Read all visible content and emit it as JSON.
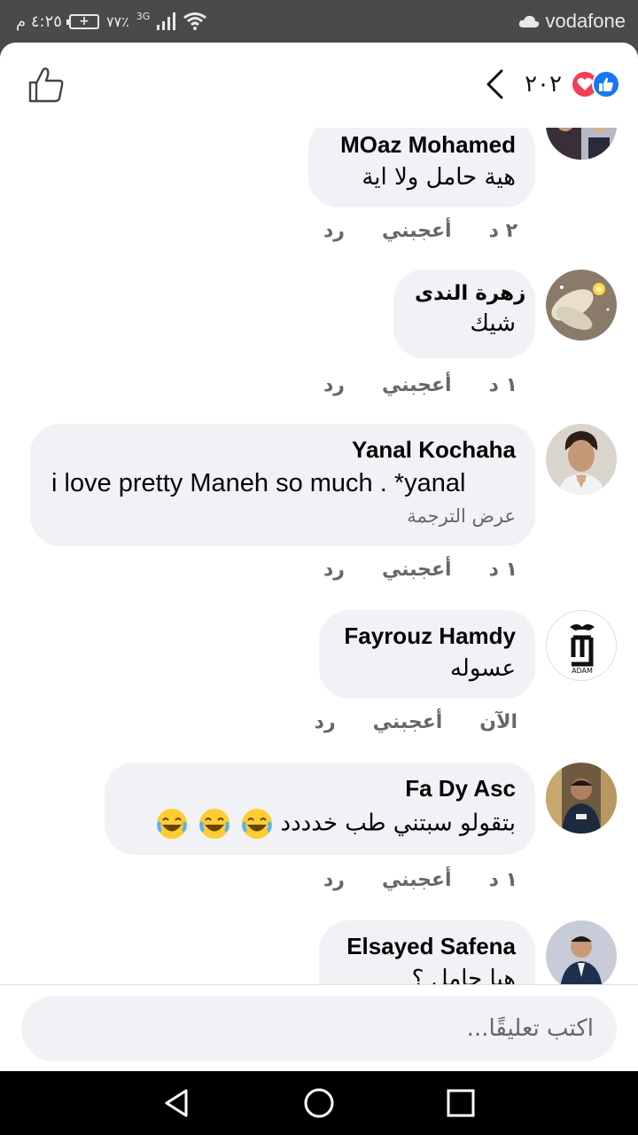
{
  "status_bar": {
    "time": "٤:٢٥ م",
    "battery": "٧٧٪",
    "network": "3G",
    "carrier": "vodafone"
  },
  "header": {
    "reaction_count": "٢٠٢",
    "reactions": [
      "like",
      "love"
    ]
  },
  "comments": [
    {
      "author": "MOaz Mohamed",
      "text": "هية حامل ولا اية",
      "time": "٢ د",
      "like_label": "أعجبني",
      "reply_label": "رد"
    },
    {
      "author": "زهرة الندى",
      "text": "شيك",
      "time": "١ د",
      "like_label": "أعجبني",
      "reply_label": "رد"
    },
    {
      "author": "Yanal Kochaha",
      "text": "i love pretty Maneh so much . *yanal",
      "translate": "عرض الترجمة",
      "time": "١ د",
      "like_label": "أعجبني",
      "reply_label": "رد"
    },
    {
      "author": "Fayrouz Hamdy",
      "text": "عسوله",
      "time": "الآن",
      "like_label": "أعجبني",
      "reply_label": "رد"
    },
    {
      "author": "Fa Dy Asc",
      "text": "بتقولو سبتني طب خدددد",
      "time": "١ د",
      "like_label": "أعجبني",
      "reply_label": "رد"
    },
    {
      "author": "Elsayed Safena",
      "text": "هيا حامل ؟"
    }
  ],
  "composer": {
    "placeholder": "اكتب تعليقًا..."
  },
  "colors": {
    "facebook_blue": "#1877f2",
    "love_red": "#f33e58",
    "bubble_bg": "#f0f2f5",
    "meta_gray": "#65676b"
  }
}
